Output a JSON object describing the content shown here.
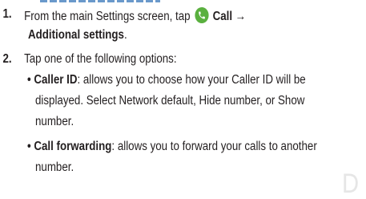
{
  "header_sliver": "",
  "steps": [
    {
      "number": "1.",
      "line1_prefix": "From the main Settings screen, tap ",
      "call_label": "Call",
      "arrow": "→",
      "line2_bold": "Additional settings",
      "line2_suffix": "."
    },
    {
      "number": "2.",
      "text": "Tap one of the following options:",
      "options": [
        {
          "bullet": "•",
          "title": "Caller ID",
          "line1_rest": ": allows you to choose how your Caller ID will be",
          "line2": "displayed. Select Network default, Hide number, or Show",
          "line3": "number."
        },
        {
          "bullet": "•",
          "title": "Call forwarding",
          "line1_rest": ": allows you to forward your calls to another",
          "line2": "number."
        }
      ]
    }
  ],
  "corner_glyph": "D",
  "colors": {
    "text": "#231f20",
    "call_icon": "#5ab03f",
    "corner_glyph": "#e6e6e6"
  },
  "icons": {
    "call_icon": "phone-handset-icon"
  }
}
